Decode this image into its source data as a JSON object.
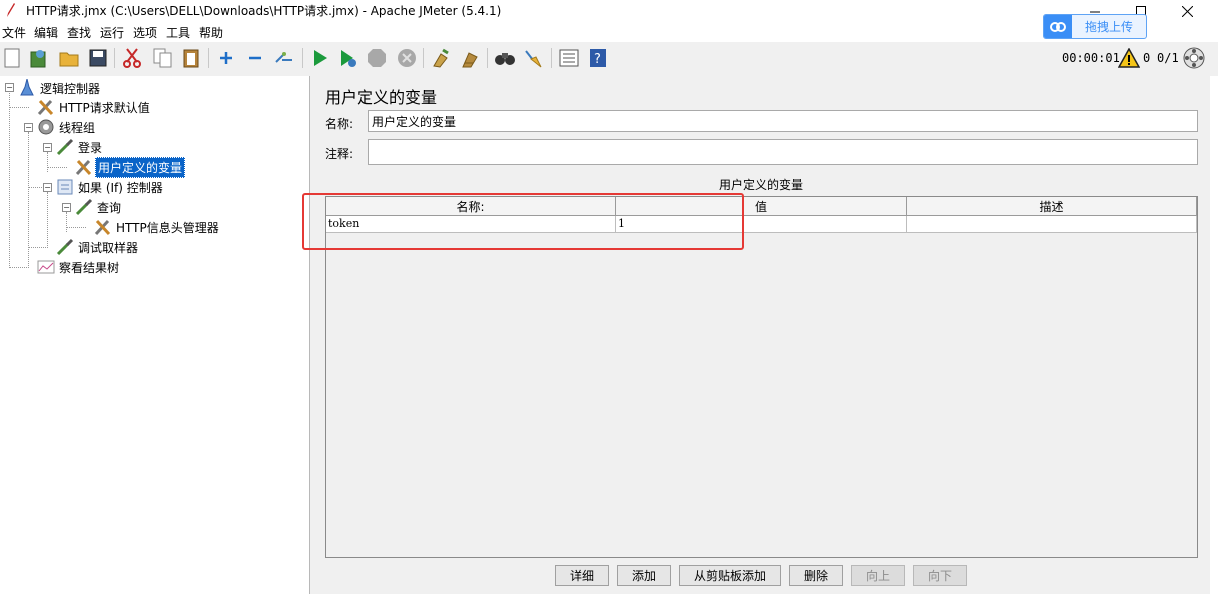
{
  "window": {
    "title": "HTTP请求.jmx (C:\\Users\\DELL\\Downloads\\HTTP请求.jmx) - Apache JMeter (5.4.1)",
    "minimize": "—",
    "maximize": "☐",
    "close": "✕"
  },
  "overlay": {
    "upload_label": "拖拽上传"
  },
  "menu": [
    "文件",
    "编辑",
    "查找",
    "运行",
    "选项",
    "工具",
    "帮助"
  ],
  "toolbar": {
    "timer": "00:00:01",
    "warning_count": "0",
    "threads": "0/1"
  },
  "tree": [
    {
      "label": "逻辑控制器",
      "icon": "test-plan-icon"
    },
    {
      "label": "HTTP请求默认值",
      "icon": "config-wrench-icon"
    },
    {
      "label": "线程组",
      "icon": "thread-group-gear-icon"
    },
    {
      "label": "登录",
      "icon": "sampler-pipette-icon"
    },
    {
      "label": "用户定义的变量",
      "icon": "config-wrench-icon"
    },
    {
      "label": "如果 (If) 控制器",
      "icon": "controller-icon"
    },
    {
      "label": "查询",
      "icon": "sampler-pipette-icon"
    },
    {
      "label": "HTTP信息头管理器",
      "icon": "config-wrench-icon"
    },
    {
      "label": "调试取样器",
      "icon": "sampler-pipette-icon"
    },
    {
      "label": "察看结果树",
      "icon": "listener-graph-icon"
    }
  ],
  "panel": {
    "title": "用户定义的变量",
    "name_label": "名称:",
    "name_value": "用户定义的变量",
    "comment_label": "注释:",
    "comment_value": "",
    "table_caption": "用户定义的变量",
    "columns": [
      "名称:",
      "值",
      "描述"
    ],
    "rows": [
      {
        "name": "token",
        "value": "1",
        "desc": ""
      }
    ],
    "buttons": {
      "detail": "详细",
      "add": "添加",
      "add_clipboard": "从剪贴板添加",
      "delete": "删除",
      "up": "向上",
      "down": "向下"
    }
  }
}
